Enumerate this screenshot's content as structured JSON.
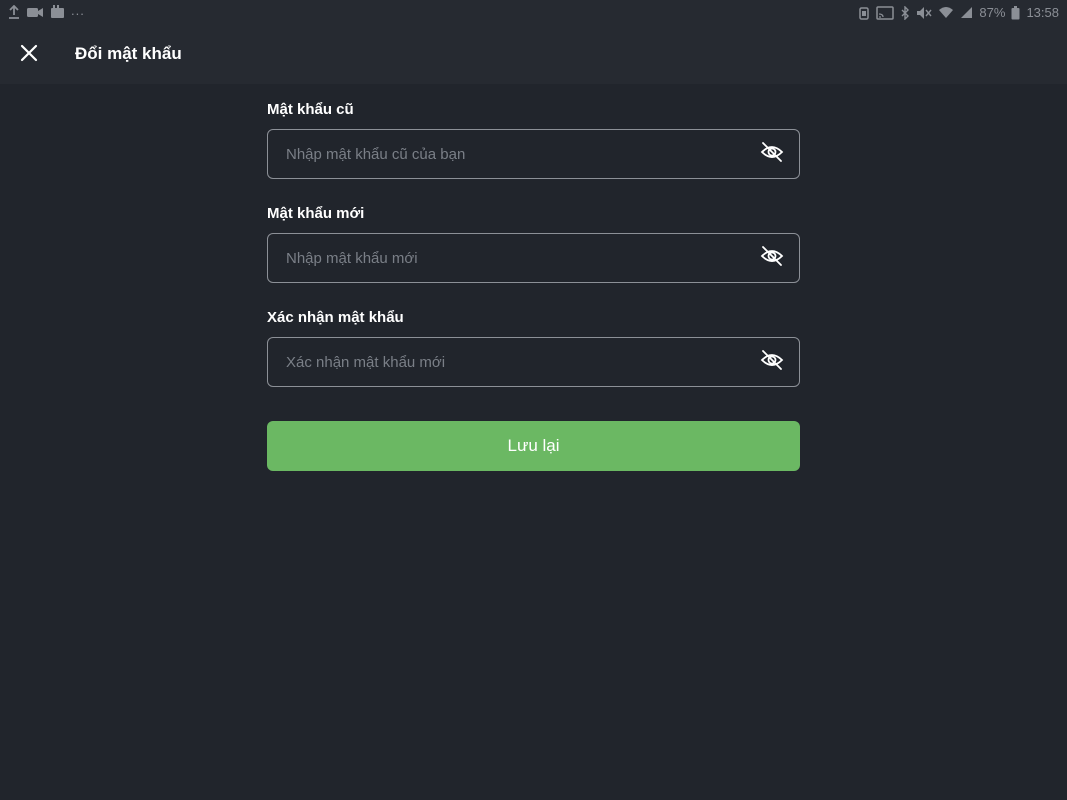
{
  "status_bar": {
    "battery": "87%",
    "time": "13:58",
    "overflow": "..."
  },
  "header": {
    "title": "Đổi mật khẩu"
  },
  "form": {
    "old_password": {
      "label": "Mật khẩu cũ",
      "placeholder": "Nhập mật khẩu cũ của bạn",
      "value": ""
    },
    "new_password": {
      "label": "Mật khẩu mới",
      "placeholder": "Nhập mật khẩu mới",
      "value": ""
    },
    "confirm_password": {
      "label": "Xác nhận mật khẩu",
      "placeholder": "Xác nhận mật khẩu mới",
      "value": ""
    },
    "save_label": "Lưu lại"
  },
  "colors": {
    "background": "#21252c",
    "header": "#262a31",
    "field_border": "#8c9097",
    "placeholder": "#7a7f87",
    "accent_green": "#6bb863",
    "status_icons": "#8b8f96"
  },
  "icons": {
    "close": "close-icon",
    "visibility": "eye-off-icon"
  }
}
